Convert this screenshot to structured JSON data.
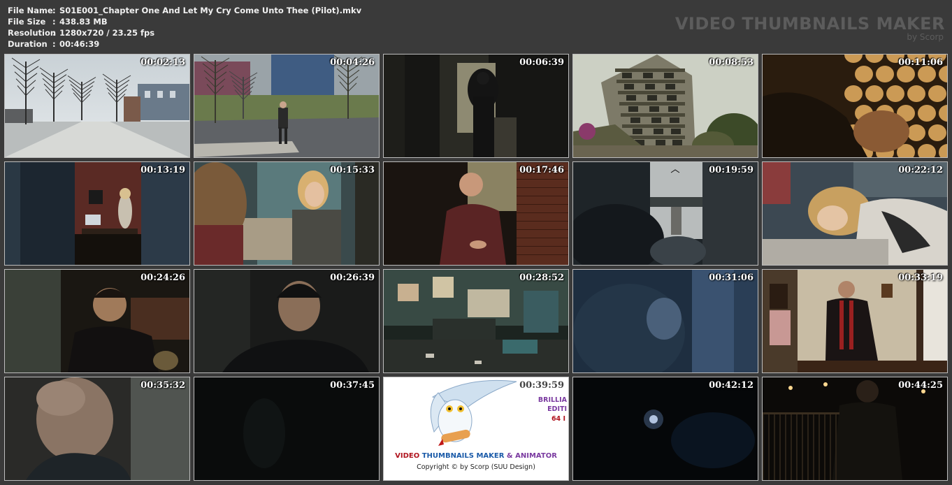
{
  "info": {
    "rows": [
      {
        "label": "File Name",
        "value": "S01E001_Chapter One And Let My Cry Come Unto Thee (Pilot).mkv"
      },
      {
        "label": "File Size",
        "value": "438.83 MB"
      },
      {
        "label": "Resolution",
        "value": "1280x720 / 23.25 fps"
      },
      {
        "label": "Duration",
        "value": "00:46:39"
      }
    ],
    "separator": ":"
  },
  "brand": {
    "title": "VIDEO THUMBNAILS MAKER",
    "subtitle": "by Scorp"
  },
  "thumbnails": [
    {
      "timestamp": "00:02:13",
      "scene": "winter-street"
    },
    {
      "timestamp": "00:04:26",
      "scene": "man-crosswalk"
    },
    {
      "timestamp": "00:06:39",
      "scene": "dark-hallway-figure"
    },
    {
      "timestamp": "00:08:53",
      "scene": "tall-building"
    },
    {
      "timestamp": "00:11:06",
      "scene": "closeup-glow"
    },
    {
      "timestamp": "00:13:19",
      "scene": "dining-room"
    },
    {
      "timestamp": "00:15:33",
      "scene": "girls-talking"
    },
    {
      "timestamp": "00:17:46",
      "scene": "man-speaking"
    },
    {
      "timestamp": "00:19:59",
      "scene": "window-view"
    },
    {
      "timestamp": "00:22:12",
      "scene": "girl-on-bed"
    },
    {
      "timestamp": "00:24:26",
      "scene": "man-dark-room"
    },
    {
      "timestamp": "00:26:39",
      "scene": "man-closeup"
    },
    {
      "timestamp": "00:28:52",
      "scene": "messy-basement"
    },
    {
      "timestamp": "00:31:06",
      "scene": "blue-doorway"
    },
    {
      "timestamp": "00:33:19",
      "scene": "priest-hallway"
    },
    {
      "timestamp": "00:35:32",
      "scene": "bald-man"
    },
    {
      "timestamp": "00:37:45",
      "scene": "pitch-dark"
    },
    {
      "timestamp": "00:39:59",
      "scene": "logo"
    },
    {
      "timestamp": "00:42:12",
      "scene": "flashlight-dark"
    },
    {
      "timestamp": "00:44:25",
      "scene": "night-street"
    }
  ],
  "logo_tile": {
    "title_part1": "VIDEO",
    "title_part2": "THUMBNAILS MAKER",
    "title_part3": "& ANIMATOR",
    "copyright": "Copyright © by Scorp (SUU Design)",
    "side_line1": "BRILLIA",
    "side_line2": "EDITI",
    "side_line3": "64 I",
    "colors": {
      "red": "#b0141e",
      "blue": "#1a5aa8",
      "purple": "#7a3aa0",
      "black": "#111111"
    }
  }
}
